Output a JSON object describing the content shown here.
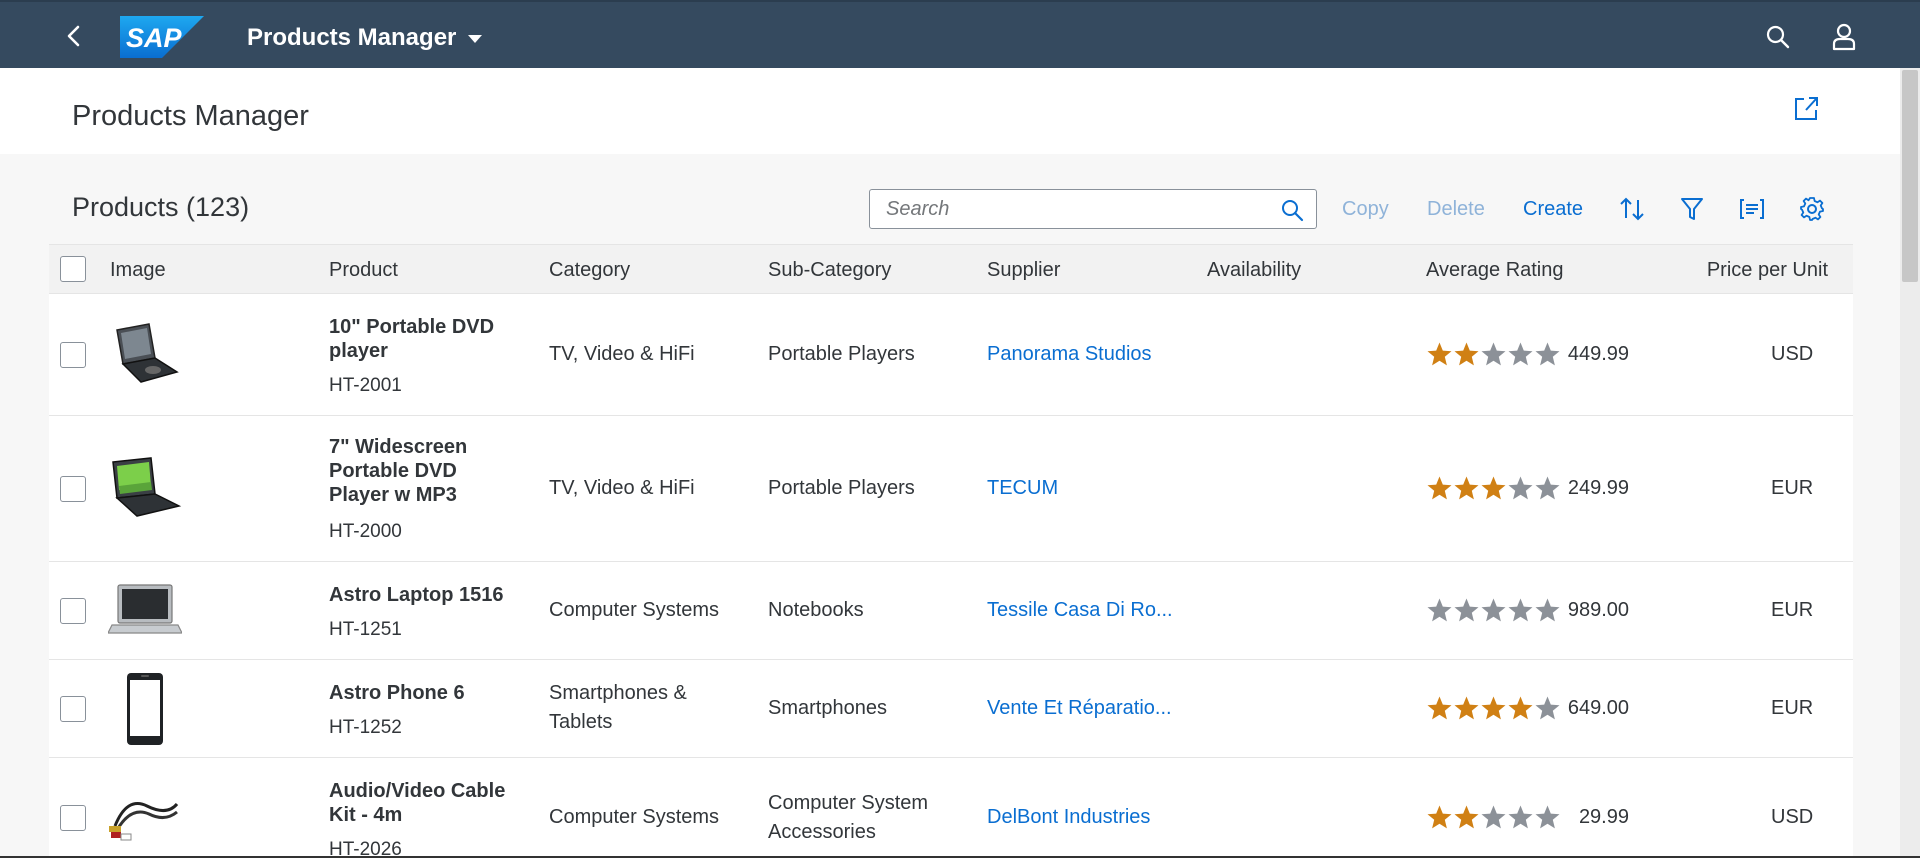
{
  "shell": {
    "logo_text": "SAP",
    "app_title": "Products Manager",
    "icons": {
      "back": "chevron-left-icon",
      "search": "search-icon",
      "user": "user-icon"
    },
    "colors": {
      "bar": "#354a5f",
      "logo": "#0a6ed1"
    }
  },
  "page": {
    "title": "Products Manager",
    "share_icon": "share-icon"
  },
  "table": {
    "title": "Products (123)",
    "search_placeholder": "Search",
    "search_value": "",
    "toolbar": {
      "copy": "Copy",
      "delete": "Delete",
      "create": "Create",
      "icons": [
        "sort-icon",
        "filter-icon",
        "group-icon",
        "settings-icon"
      ]
    },
    "columns": [
      "Image",
      "Product",
      "Category",
      "Sub-Category",
      "Supplier",
      "Availability",
      "Average Rating",
      "Price per Unit"
    ],
    "rows": [
      {
        "image": "portable-dvd-player-image",
        "name_lines": [
          "10\" Portable DVD",
          "player"
        ],
        "id": "HT-2001",
        "category_lines": [
          "TV, Video & HiFi"
        ],
        "subcategory_lines": [
          "Portable Players"
        ],
        "supplier": "Panorama Studios",
        "availability": "",
        "rating": 2,
        "price": "449.99",
        "currency": "USD"
      },
      {
        "image": "widescreen-dvd-player-image",
        "name_lines": [
          "7\" Widescreen",
          "Portable DVD",
          "Player w MP3"
        ],
        "id": "HT-2000",
        "category_lines": [
          "TV, Video & HiFi"
        ],
        "subcategory_lines": [
          "Portable Players"
        ],
        "supplier": "TECUM",
        "availability": "",
        "rating": 3,
        "price": "249.99",
        "currency": "EUR"
      },
      {
        "image": "laptop-image",
        "name_lines": [
          "Astro Laptop 1516"
        ],
        "id": "HT-1251",
        "category_lines": [
          "Computer Systems"
        ],
        "subcategory_lines": [
          "Notebooks"
        ],
        "supplier": "Tessile Casa Di Ro...",
        "availability": "",
        "rating": 0,
        "price": "989.00",
        "currency": "EUR"
      },
      {
        "image": "smartphone-image",
        "name_lines": [
          "Astro Phone 6"
        ],
        "id": "HT-1252",
        "category_lines": [
          "Smartphones &",
          "Tablets"
        ],
        "subcategory_lines": [
          "Smartphones"
        ],
        "supplier": "Vente Et Réparatio...",
        "availability": "",
        "rating": 4,
        "price": "649.00",
        "currency": "EUR"
      },
      {
        "image": "cable-kit-image",
        "name_lines": [
          "Audio/Video Cable",
          "Kit - 4m"
        ],
        "id": "HT-2026",
        "category_lines": [
          "Computer Systems"
        ],
        "subcategory_lines": [
          "Computer System",
          "Accessories"
        ],
        "supplier": "DelBont Industries",
        "availability": "",
        "rating": 2,
        "price": "29.99",
        "currency": "USD"
      }
    ],
    "rating_max": 5,
    "colors": {
      "star_on": "#d08014",
      "star_off": "#8c9198",
      "link": "#0a6ed1"
    }
  }
}
